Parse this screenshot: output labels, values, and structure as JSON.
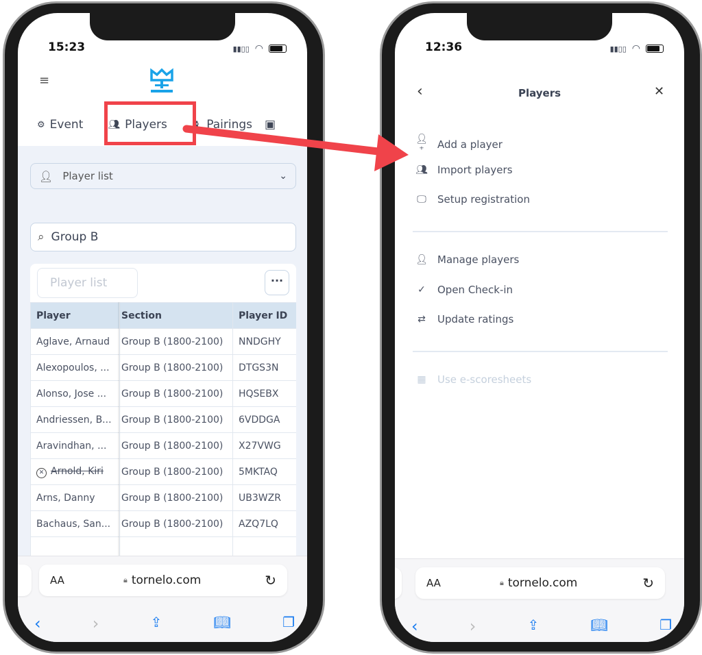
{
  "left": {
    "status": {
      "time": "15:23"
    },
    "tabs": [
      {
        "label": "Event",
        "icon": "gears-icon"
      },
      {
        "label": "Players",
        "icon": "users-icon"
      },
      {
        "label": "Pairings",
        "icon": "chess-icon"
      }
    ],
    "view_select": {
      "value": "Player list"
    },
    "search": {
      "value": "Group B"
    },
    "list_name": {
      "placeholder": "Player list"
    },
    "more_label": "···",
    "table": {
      "headers": [
        "Player",
        "Section",
        "Player ID"
      ],
      "rows": [
        {
          "player": "Aglave, Arnaud",
          "section": "Group B (1800-2100)",
          "id": "NNDGHY",
          "withdrawn": false
        },
        {
          "player": "Alexopoulos, ...",
          "section": "Group B (1800-2100)",
          "id": "DTGS3N",
          "withdrawn": false
        },
        {
          "player": "Alonso, Jose ...",
          "section": "Group B (1800-2100)",
          "id": "HQSEBX",
          "withdrawn": false
        },
        {
          "player": "Andriessen, B...",
          "section": "Group B (1800-2100)",
          "id": "6VDDGA",
          "withdrawn": false
        },
        {
          "player": "Aravindhan, ...",
          "section": "Group B (1800-2100)",
          "id": "X27VWG",
          "withdrawn": false
        },
        {
          "player": "Arnold, Kiri",
          "section": "Group B (1800-2100)",
          "id": "5MKTAQ",
          "withdrawn": true
        },
        {
          "player": "Arns, Danny",
          "section": "Group B (1800-2100)",
          "id": "UB3WZR",
          "withdrawn": false
        },
        {
          "player": "Bachaus, San...",
          "section": "Group B (1800-2100)",
          "id": "AZQ7LQ",
          "withdrawn": false
        }
      ]
    },
    "browser": {
      "text_size": "AA",
      "url": "tornelo.com"
    }
  },
  "right": {
    "status": {
      "time": "12:36"
    },
    "title": "Players",
    "menu_groups": [
      [
        {
          "label": "Add a player",
          "icon": "add-user-icon"
        },
        {
          "label": "Import players",
          "icon": "import-users-icon"
        },
        {
          "label": "Setup registration",
          "icon": "monitor-download-icon"
        }
      ],
      [
        {
          "label": "Manage players",
          "icon": "edit-user-icon"
        },
        {
          "label": "Open Check-in",
          "icon": "check-icon"
        },
        {
          "label": "Update ratings",
          "icon": "refresh-icon"
        }
      ],
      [
        {
          "label": "Use e-scoresheets",
          "icon": "qr-icon",
          "disabled": true
        }
      ]
    ],
    "browser": {
      "text_size": "AA",
      "url": "tornelo.com"
    }
  },
  "colors": {
    "brand": "#1aa3e8",
    "highlight": "#f0434a",
    "ios_blue": "#1a7cf0"
  }
}
